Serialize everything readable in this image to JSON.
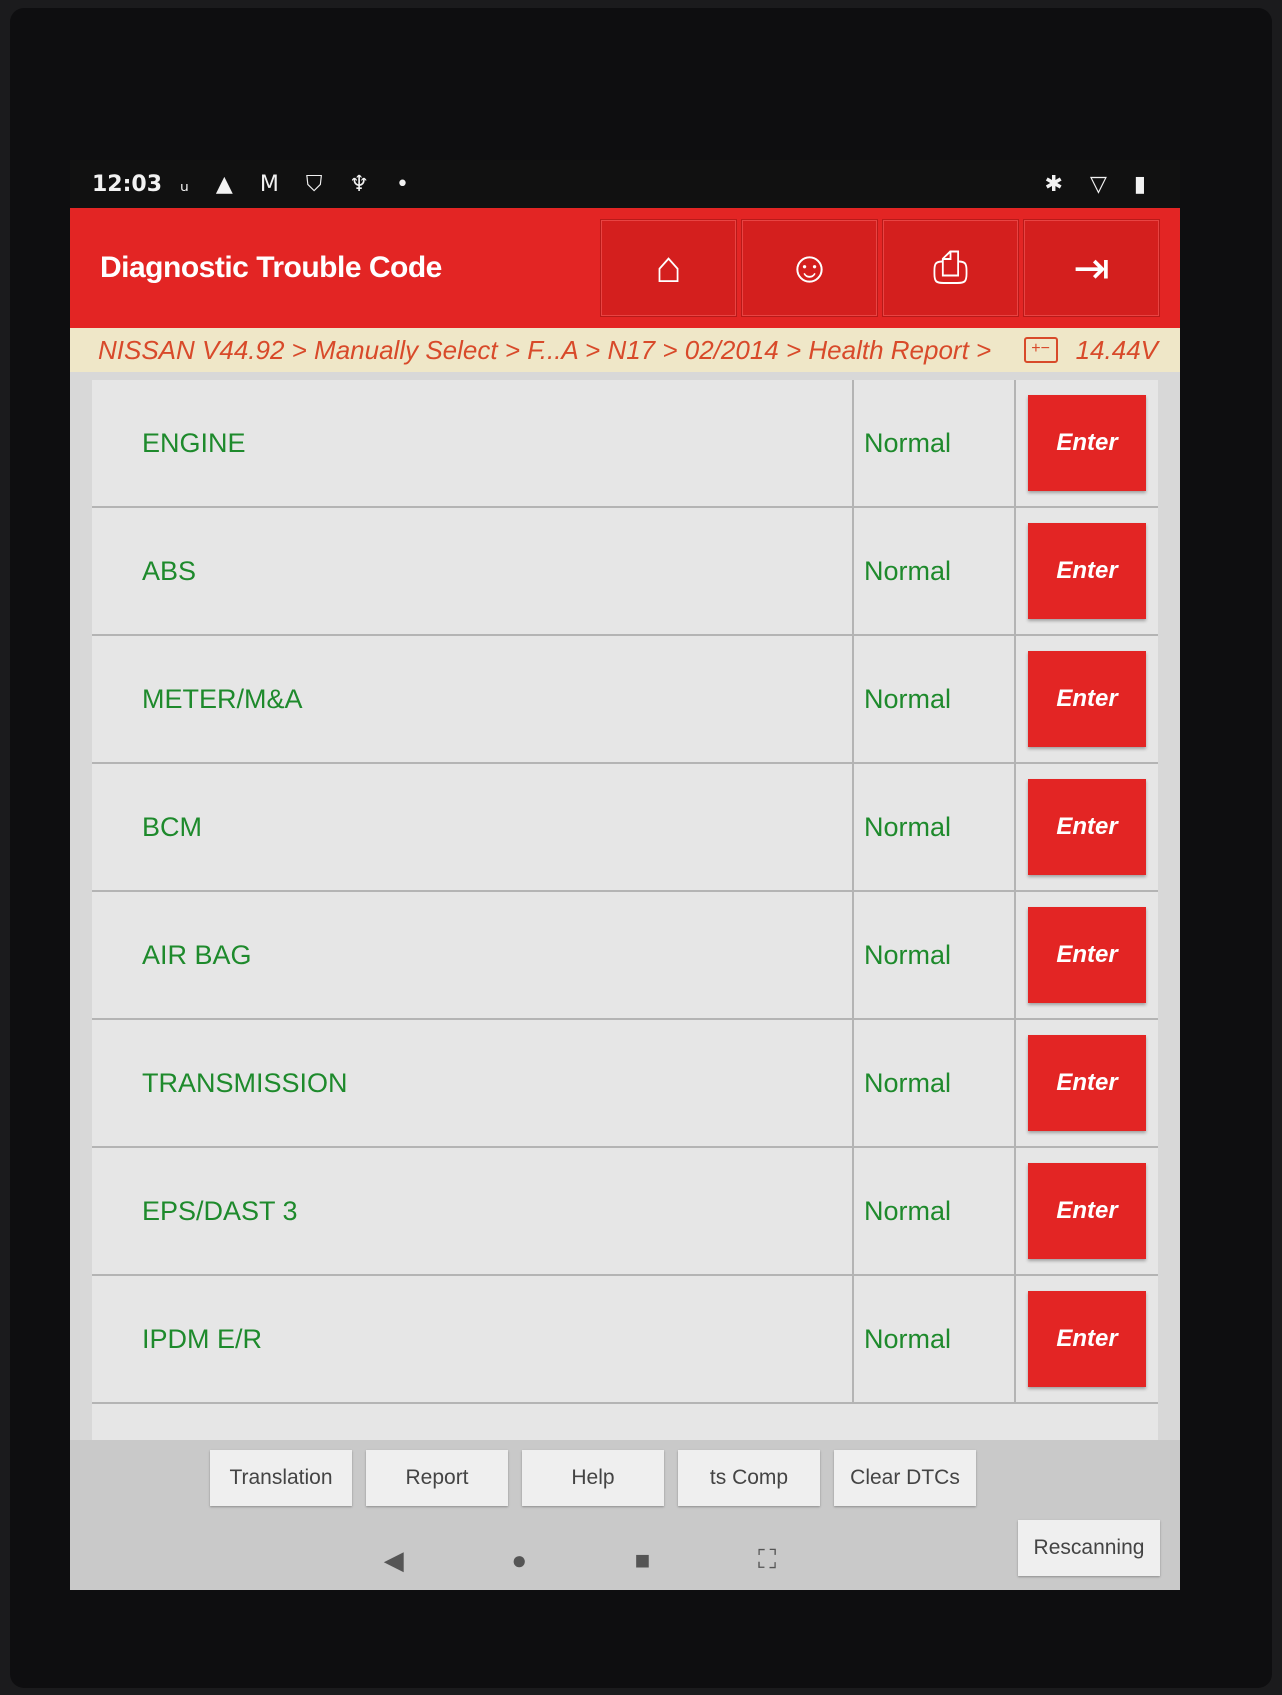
{
  "status_bar": {
    "time": "12:03",
    "notifications": "ᵤ ▲ M ⛉ ♆ •",
    "system_icons": "✱ ▽ ▮"
  },
  "header": {
    "title": "Diagnostic Trouble Code",
    "buttons": [
      {
        "icon": "home-icon",
        "glyph": "⌂"
      },
      {
        "icon": "support-icon",
        "glyph": "☺"
      },
      {
        "icon": "print-icon",
        "glyph": "⎙"
      },
      {
        "icon": "exit-icon",
        "glyph": "⇥"
      }
    ]
  },
  "breadcrumb": {
    "path": "NISSAN V44.92 > Manually Select > F...A > N17 > 02/2014 > Health Report >",
    "battery_glyph": "+−",
    "voltage": "14.44V"
  },
  "systems": [
    {
      "name": "ENGINE",
      "status": "Normal",
      "action": "Enter"
    },
    {
      "name": "ABS",
      "status": "Normal",
      "action": "Enter"
    },
    {
      "name": "METER/M&A",
      "status": "Normal",
      "action": "Enter"
    },
    {
      "name": "BCM",
      "status": "Normal",
      "action": "Enter"
    },
    {
      "name": "AIR BAG",
      "status": "Normal",
      "action": "Enter"
    },
    {
      "name": "TRANSMISSION",
      "status": "Normal",
      "action": "Enter"
    },
    {
      "name": "EPS/DAST 3",
      "status": "Normal",
      "action": "Enter"
    },
    {
      "name": "IPDM E/R",
      "status": "Normal",
      "action": "Enter"
    }
  ],
  "bottom_buttons": {
    "translation": "Translation",
    "report": "Report",
    "help": "Help",
    "compare": "ts Comp",
    "clear_dtcs": "Clear DTCs",
    "rescanning": "Rescanning"
  },
  "nav_bar": {
    "back": "◀",
    "home": "●",
    "recents": "■",
    "extra": "⛶"
  },
  "colors": {
    "accent_red": "#e32524",
    "status_green": "#1e8a2c",
    "breadcrumb_text": "#d84a2a"
  }
}
